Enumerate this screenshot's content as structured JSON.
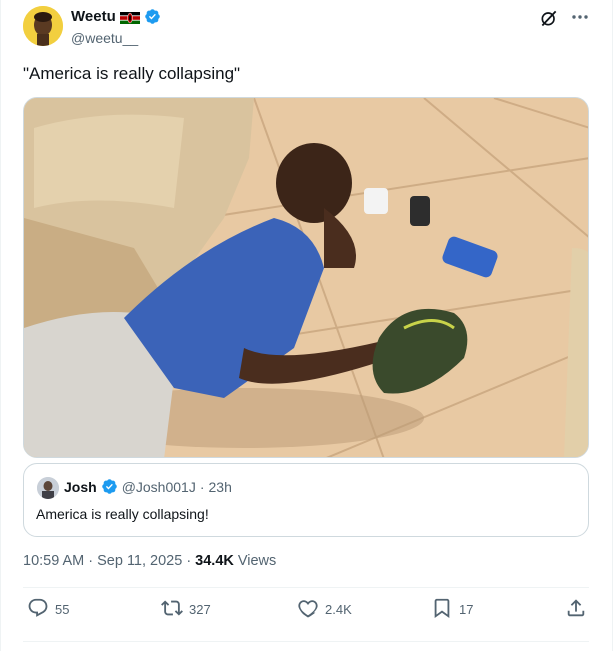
{
  "author": {
    "display_name": "Weetu",
    "handle": "@weetu__"
  },
  "tweet": {
    "text": "\"America is really collapsing\""
  },
  "photo": {
    "description_icon": "photo-image"
  },
  "quote": {
    "display_name": "Josh",
    "handle": "@Josh001J",
    "separator": "·",
    "time": "23h",
    "text": "America is really collapsing!"
  },
  "meta": {
    "time": "10:59 AM",
    "separator": "·",
    "date": "Sep 11, 2025",
    "separator2": "·",
    "views_count": "34.4K",
    "views_label": "Views"
  },
  "actions": {
    "replies": "55",
    "retweets": "327",
    "likes": "2.4K",
    "bookmarks": "17"
  },
  "colors": {
    "verified": "#1d9bf0",
    "text": "#0f1419",
    "secondary": "#536471",
    "border": "#cfd9de"
  },
  "icons": [
    "kenya-flag-icon",
    "verified-icon",
    "grok-icon",
    "more-icon",
    "reply-icon",
    "retweet-icon",
    "like-icon",
    "bookmark-icon",
    "share-icon"
  ]
}
